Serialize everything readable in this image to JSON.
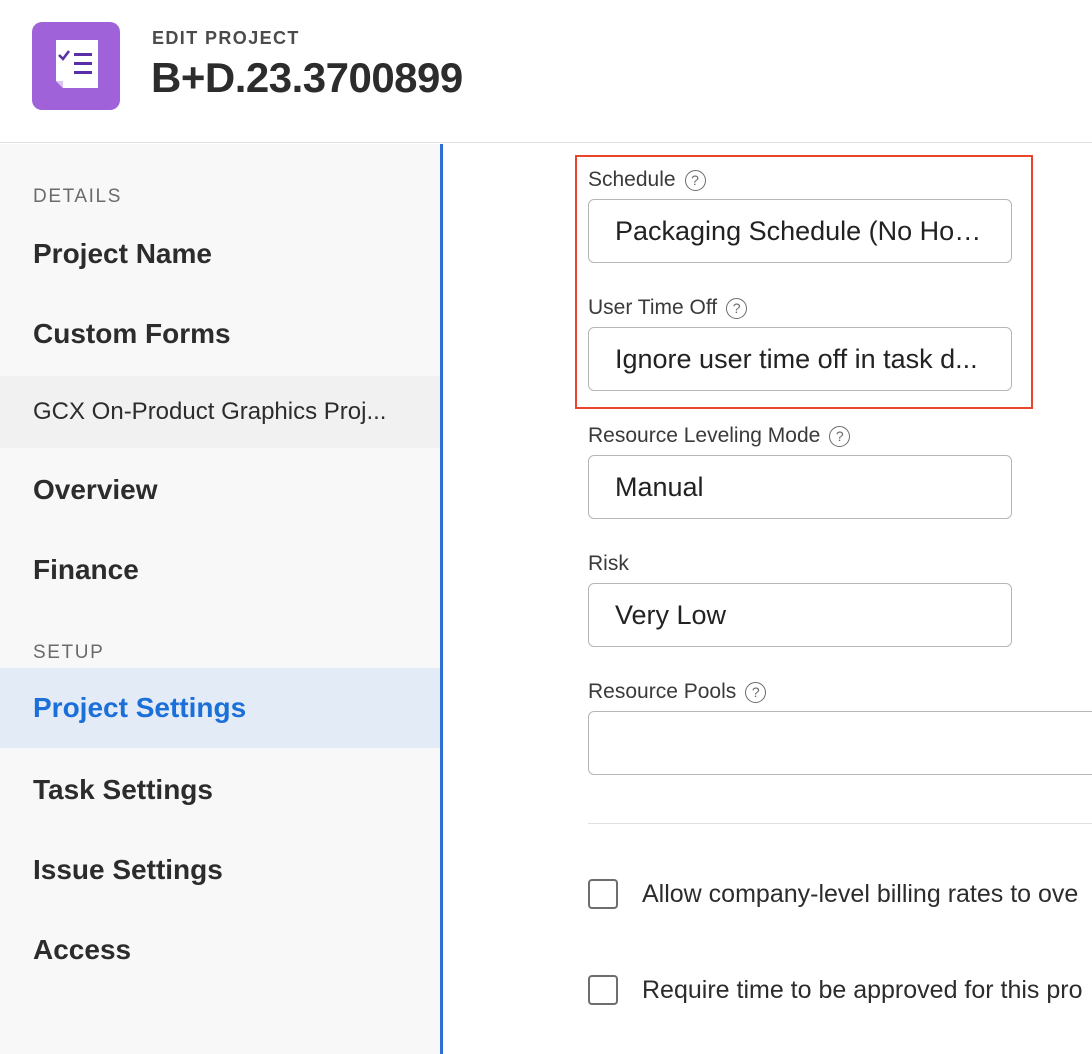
{
  "header": {
    "eyebrow": "EDIT PROJECT",
    "title": "B+D.23.3700899",
    "icon": "project-checklist-icon",
    "icon_color": "#9f62d8"
  },
  "sidebar": {
    "sections": [
      {
        "label": "DETAILS"
      },
      {
        "label": "SETUP"
      }
    ],
    "items": [
      {
        "label": "Project Name"
      },
      {
        "label": "Custom Forms"
      },
      {
        "label": "GCX On-Product Graphics Proj..."
      },
      {
        "label": "Overview"
      },
      {
        "label": "Finance"
      },
      {
        "label": "Project Settings",
        "active": true
      },
      {
        "label": "Task Settings"
      },
      {
        "label": "Issue Settings"
      },
      {
        "label": "Access"
      }
    ],
    "active_color": "#1b6fd9"
  },
  "fields": [
    {
      "label": "Schedule",
      "value": "Packaging Schedule (No Holi...",
      "help": true
    },
    {
      "label": "User Time Off",
      "value": "Ignore user time off in task d...",
      "help": true
    },
    {
      "label": "Resource Leveling Mode",
      "value": "Manual",
      "help": true
    },
    {
      "label": "Risk",
      "value": "Very Low",
      "help": false
    },
    {
      "label": "Resource Pools",
      "value": "",
      "help": true
    }
  ],
  "checkboxes": [
    {
      "label": "Allow company-level billing rates to ove",
      "checked": false
    },
    {
      "label": "Require time to be approved for this pro",
      "checked": false
    }
  ],
  "help_symbol": "?",
  "highlight_color": "#e8452c"
}
